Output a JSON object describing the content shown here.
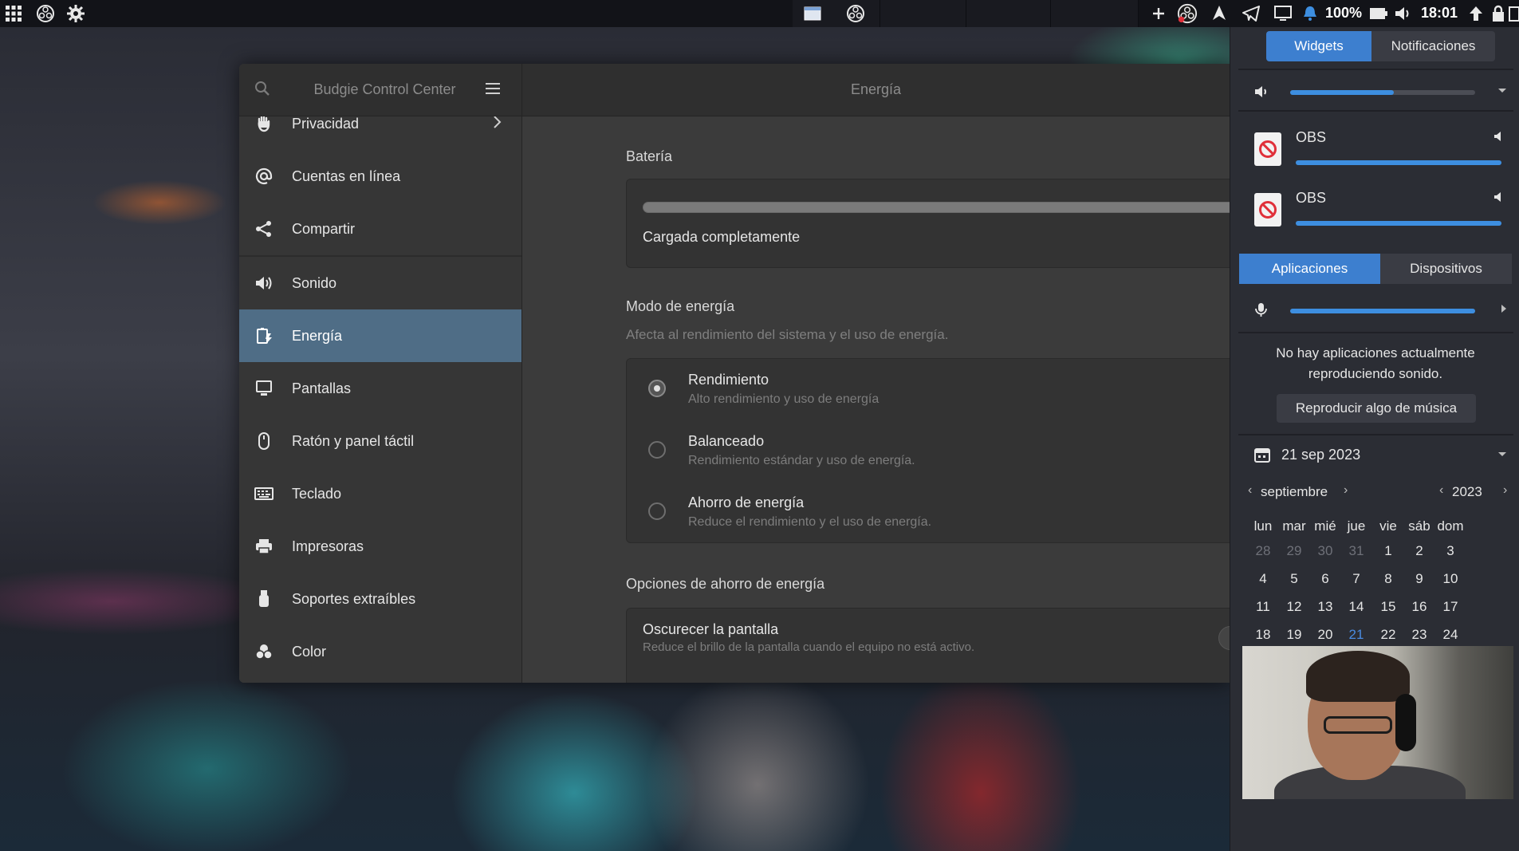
{
  "top_panel": {
    "battery_percent": "100%",
    "clock": "18:01",
    "icons": [
      "apps-grid-icon",
      "obs-icon",
      "settings-gear-icon",
      "window-icon",
      "obs-icon",
      "plus-icon",
      "obs-recording-icon",
      "app-icon",
      "telegram-icon",
      "display-icon",
      "notification-bell-icon",
      "volume-icon",
      "battery-icon",
      "upload-icon",
      "lock-icon"
    ]
  },
  "control_center": {
    "app_title": "Budgie Control Center",
    "page_title": "Energía",
    "sidebar": [
      {
        "label": "Privacidad",
        "icon": "hand-icon",
        "chevron": true
      },
      {
        "label": "Cuentas en línea",
        "icon": "at-sign-icon"
      },
      {
        "label": "Compartir",
        "icon": "share-icon"
      },
      {
        "label": "Sonido",
        "icon": "speaker-icon"
      },
      {
        "label": "Energía",
        "icon": "power-battery-icon",
        "active": true
      },
      {
        "label": "Pantallas",
        "icon": "monitor-icon"
      },
      {
        "label": "Ratón y panel táctil",
        "icon": "mouse-icon"
      },
      {
        "label": "Teclado",
        "icon": "keyboard-icon"
      },
      {
        "label": "Impresoras",
        "icon": "printer-icon"
      },
      {
        "label": "Soportes extraíbles",
        "icon": "usb-icon"
      },
      {
        "label": "Color",
        "icon": "color-icon"
      }
    ],
    "battery": {
      "title": "Batería",
      "level": 1.0,
      "status": "Cargada completamente"
    },
    "power_mode": {
      "title": "Modo de energía",
      "subtitle": "Afecta al rendimiento del sistema y el uso de energía.",
      "options": [
        {
          "title": "Rendimiento",
          "desc": "Alto rendimiento y uso de energía",
          "checked": true
        },
        {
          "title": "Balanceado",
          "desc": "Rendimiento estándar y uso de energía.",
          "checked": false
        },
        {
          "title": "Ahorro de energía",
          "desc": "Reduce el rendimiento y el uso de energía.",
          "checked": false
        }
      ]
    },
    "saving_options": {
      "title": "Opciones de ahorro de energía",
      "dim_title": "Oscurecer la pantalla",
      "dim_desc": "Reduce el brillo de la pantalla cuando el equipo no está activo."
    }
  },
  "raven": {
    "tabs": [
      "Widgets",
      "Notificaciones"
    ],
    "active_tab": 0,
    "master_volume": 0.56,
    "streams": [
      {
        "name": "OBS",
        "volume": 1.0
      },
      {
        "name": "OBS",
        "volume": 1.0
      }
    ],
    "mixer_tabs": [
      "Aplicaciones",
      "Dispositivos"
    ],
    "mixer_active": 0,
    "mic_volume": 1.0,
    "no_apps_message": "No hay aplicaciones actualmente reproduciendo sonido.",
    "play_music_button": "Reproducir algo de música",
    "calendar": {
      "date_label": "21 sep 2023",
      "month": "septiembre",
      "year": "2023",
      "weekdays": [
        "lun",
        "mar",
        "mié",
        "jue",
        "vie",
        "sáb",
        "dom"
      ],
      "weeks": [
        [
          "28",
          "29",
          "30",
          "31",
          "1",
          "2",
          "3"
        ],
        [
          "4",
          "5",
          "6",
          "7",
          "8",
          "9",
          "10"
        ],
        [
          "11",
          "12",
          "13",
          "14",
          "15",
          "16",
          "17"
        ],
        [
          "18",
          "19",
          "20",
          "21",
          "22",
          "23",
          "24"
        ]
      ],
      "dim_days_first_row": 4,
      "today": "21"
    }
  },
  "colors": {
    "accent": "#3d7fcf",
    "sidebar_active": "#4f6d86"
  }
}
